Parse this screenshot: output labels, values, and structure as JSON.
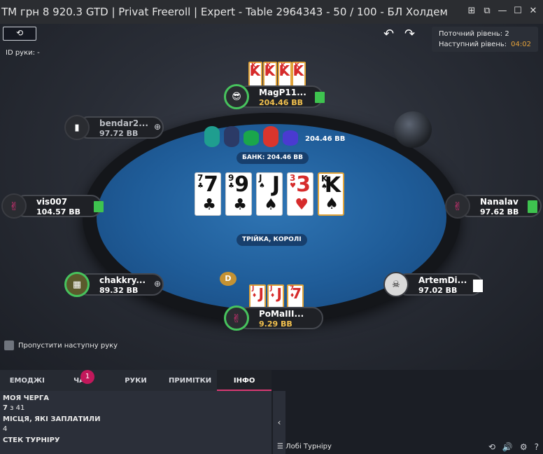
{
  "window": {
    "title": "TM грн 8 920.3 GTD | Privat Freeroll | Expert - Table 2964343 - 50 / 100 - БЛ Холдем",
    "icons": [
      "grid-icon",
      "restore-icon",
      "minimize-icon",
      "maximize-icon",
      "close-icon"
    ]
  },
  "toolbar": {
    "hand_id": "ID руки: -"
  },
  "levels": {
    "current_label": "Поточний рівень: 2",
    "next_label": "Наступний рівень:",
    "next_time": "04:02"
  },
  "players": [
    {
      "name": "MagP11...",
      "stack": "204.46 BB",
      "note": "green",
      "active": true
    },
    {
      "name": "bendar2...",
      "stack": "97.72 BB",
      "note": "add",
      "active": false
    },
    {
      "name": "vis007",
      "stack": "104.57 BB",
      "note": "green",
      "active": false
    },
    {
      "name": "Nanalav",
      "stack": "97.62 BB",
      "note": "green",
      "active": false
    },
    {
      "name": "chakkry...",
      "stack": "89.32 BB",
      "note": "add",
      "active": false
    },
    {
      "name": "ArtemDi...",
      "stack": "97.02 BB",
      "note": "white",
      "active": false
    },
    {
      "name": "PoMaIII...",
      "stack": "9.29 BB",
      "note": "",
      "active": true
    }
  ],
  "villain_cards": [
    {
      "rank": "K",
      "suit": "♥",
      "color": "red"
    },
    {
      "rank": "K",
      "suit": "♦",
      "color": "red"
    }
  ],
  "hero_cards": [
    {
      "rank": "J",
      "suit": "♦",
      "color": "red"
    },
    {
      "rank": "7",
      "suit": "♦",
      "color": "red"
    }
  ],
  "board": [
    {
      "rank": "7",
      "suit": "♣",
      "color": "black"
    },
    {
      "rank": "9",
      "suit": "♣",
      "color": "black"
    },
    {
      "rank": "J",
      "suit": "♠",
      "color": "black"
    },
    {
      "rank": "3",
      "suit": "♥",
      "color": "red"
    },
    {
      "rank": "K",
      "suit": "♠",
      "color": "black"
    }
  ],
  "pot": {
    "amount": "204.46 BB",
    "label": "БАНК: 204.46 BB"
  },
  "hand_result": "ТРІЙКА, КОРОЛІ",
  "dealer_button": "D",
  "chip_colors": [
    "#1f9e8f",
    "#2b3a66",
    "#222",
    "#1aa64b",
    "#d9352d",
    "#4a3ad1"
  ],
  "skip_label": "Пропустити наступну руку",
  "tabs": [
    "ЕМОДЖІ",
    "ЧАТ",
    "РУКИ",
    "ПРИМІТКИ",
    "ІНФО"
  ],
  "chat_badge": "1",
  "info": {
    "my_turn_label": "МОЯ ЧЕРГА",
    "my_turn_value_bold": "7",
    "my_turn_value_rest": " з 41",
    "paid_label": "МІСЦЯ, ЯКІ ЗАПЛАТИЛИ",
    "paid_value": "4",
    "stack_label": "СТЕК ТУРНІРУ"
  },
  "lobby_label": "Лобі Турніру",
  "bottom_icons": [
    "replay-icon",
    "sound-icon",
    "settings-icon",
    "help-icon"
  ]
}
